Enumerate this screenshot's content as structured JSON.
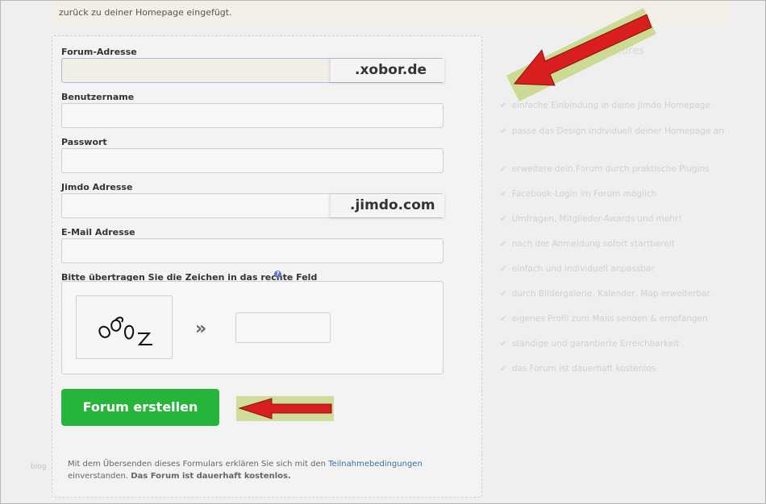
{
  "notice": {
    "text": "zurück zu deiner Homepage eingefügt."
  },
  "form": {
    "forum_address": {
      "label": "Forum-Adresse",
      "value": "",
      "suffix": ".xobor.de"
    },
    "username": {
      "label": "Benutzername",
      "value": ""
    },
    "password": {
      "label": "Passwort",
      "value": ""
    },
    "jimdo_address": {
      "label": "Jimdo Adresse",
      "value": "",
      "suffix": ".jimdo.com"
    },
    "email": {
      "label": "E-Mail Adresse",
      "value": ""
    },
    "captcha": {
      "label": "Bitte übertragen Sie die Zeichen in das rechte Feld",
      "help_icon": "question-icon",
      "image_text": "8Q0z",
      "arrow": "»",
      "value": ""
    },
    "submit_label": "Forum erstellen",
    "terms_pre": "Mit dem Übersenden dieses Formulars erklären Sie sich mit den ",
    "terms_link": "Teilnahmebedingungen",
    "terms_post": "einverstanden. ",
    "terms_bold": "Das Forum ist dauerhaft kostenlos."
  },
  "sidebar": {
    "blog_tag": "blog",
    "features_title": "eatures",
    "features": [
      "einfache Einbindung in deine Jimdo Homepage",
      "passe das Design individuell deiner Homepage an",
      "erweitere dein Forum durch praktische Plugins",
      "Facebook-Login im Forum möglich",
      "Umfragen, Mitglieder-Awards und mehr!",
      "nach der Anmeldung sofort startbereit",
      "einfach und individuell anpassbar",
      "durch Bildergalerie, Kalender, Map erweiterbar",
      "eigenes Profil zum Mails senden & empfangen",
      "ständige und garantierte Erreichbarkeit",
      "das Forum ist dauerhaft kostenlos"
    ]
  },
  "colors": {
    "submit_green": "#27b43a",
    "arrow_red": "#d81e1e",
    "arrow_highlight": "#c8d88a",
    "check_green": "#bfe7bf",
    "link_blue": "#3c6ea3"
  }
}
